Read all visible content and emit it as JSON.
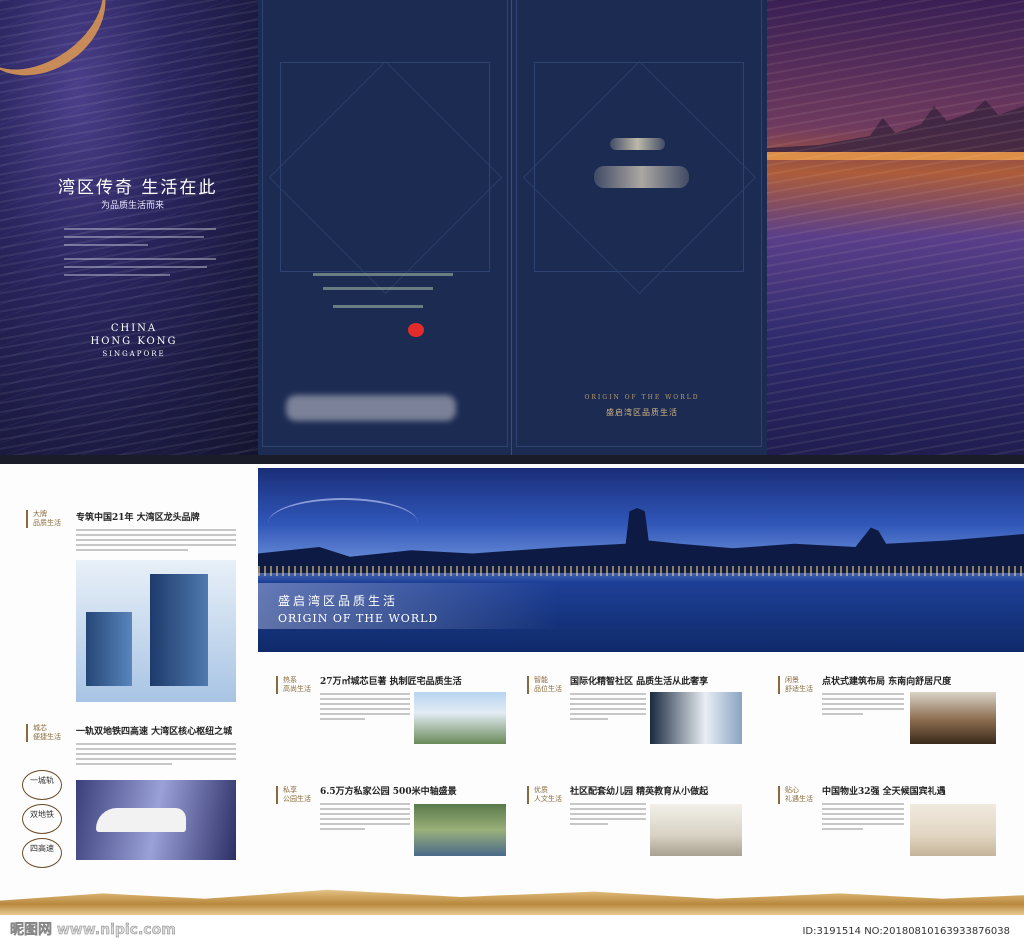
{
  "top_spread": {
    "left_panel": {
      "title": "湾区传奇 生活在此",
      "subtitle": "为品质生活而来",
      "cities": [
        "CHINA",
        "HONG KONG",
        "SINGAPORE"
      ]
    },
    "cover_panel": {
      "tagline_en": "ORIGIN OF THE WORLD",
      "tagline_cn": "盛启湾区品质生活"
    }
  },
  "bottom_spread": {
    "left_column": {
      "section1_label": [
        "大牌",
        "品质生活"
      ],
      "section1_title": "专筑中国21年 大湾区龙头品牌",
      "section2_label": [
        "城芯",
        "便捷生活"
      ],
      "section2_title": "一轨双地铁四高速 大湾区核心枢纽之城",
      "circles": [
        "一城轨",
        "双地铁",
        "四高速"
      ]
    },
    "hero": {
      "caption_cn": "盛启湾区品质生活",
      "caption_en": "ORIGIN OF THE WORLD"
    },
    "features": [
      {
        "label": [
          "热系",
          "高尚生活"
        ],
        "title": "27万㎡城芯巨著 执制匠宅品质生活"
      },
      {
        "label": [
          "智能",
          "品位生活"
        ],
        "title": "国际化精智社区 品质生活从此奢享"
      },
      {
        "label": [
          "闲景",
          "舒适生活"
        ],
        "title": "点状式建筑布局 东南向舒居尺度"
      },
      {
        "label": [
          "私享",
          "公园生活"
        ],
        "title": "6.5万方私家公园 500米中轴盛景"
      },
      {
        "label": [
          "优质",
          "人文生活"
        ],
        "title": "社区配套幼儿园 精英教育从小做起"
      },
      {
        "label": [
          "贴心",
          "礼遇生活"
        ],
        "title": "中国物业32强 全天候国宾礼遇"
      }
    ]
  },
  "watermark": {
    "left": "昵图网 www.nipic.com",
    "right": "ID:3191514 NO:20180810163933876038"
  }
}
